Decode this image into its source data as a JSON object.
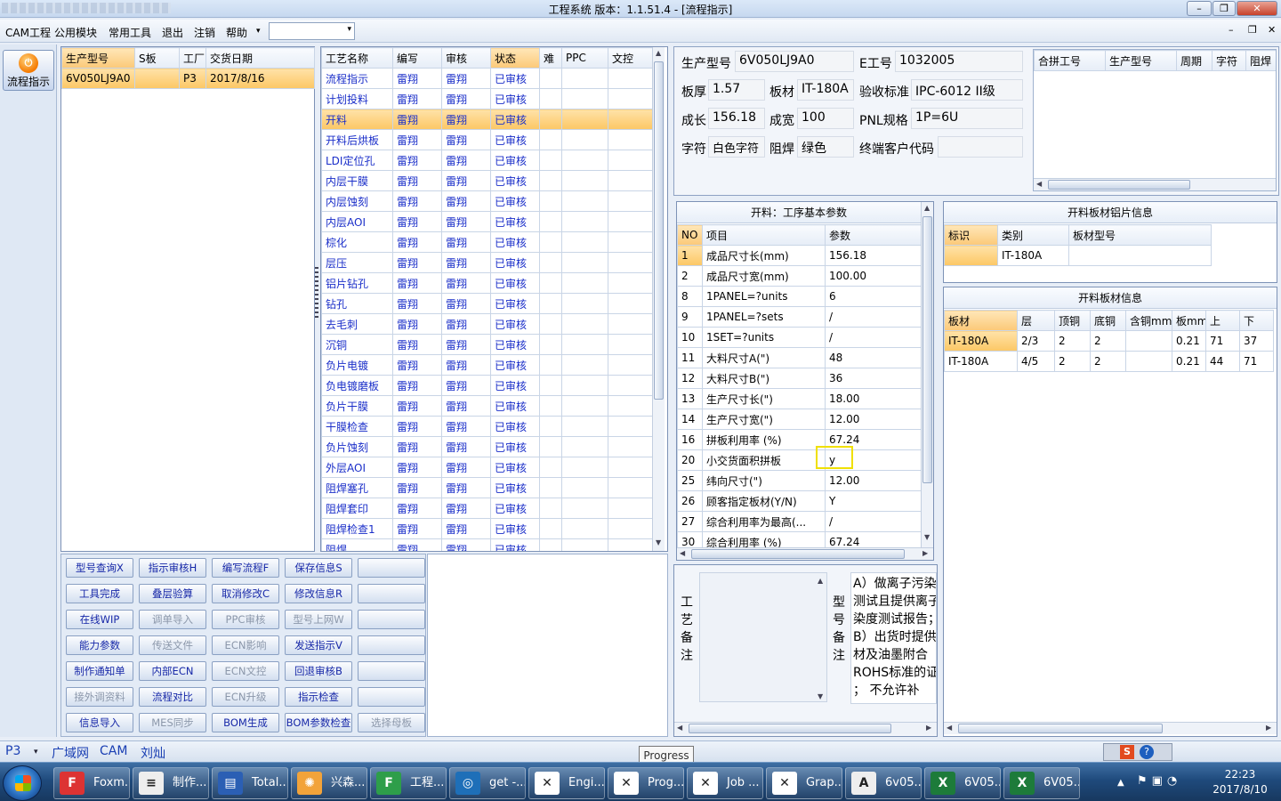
{
  "window": {
    "title": "工程系统   版本：1.1.51.4 - [流程指示]",
    "min": "–",
    "restore": "❐",
    "close": "✕"
  },
  "menu": {
    "items": [
      "CAM工程",
      "公用模块",
      "常用工具",
      "退出",
      "注销",
      "帮助"
    ],
    "help_arrow": "▾",
    "combo_arrow": "▾",
    "mdi": [
      "–",
      "❐",
      "✕"
    ]
  },
  "leftbar": {
    "flow_label": "流程指示"
  },
  "order_grid": {
    "headers": [
      "生产型号",
      "S板",
      "工厂",
      "交货日期"
    ],
    "rows": [
      [
        "6V050LJ9A0",
        "",
        "P3",
        "2017/8/16"
      ]
    ]
  },
  "process_grid": {
    "headers": [
      "工艺名称",
      "编写",
      "审核",
      "状态",
      "难",
      "PPC",
      "文控"
    ],
    "rows": [
      [
        "流程指示",
        "雷翔",
        "雷翔",
        "已审核"
      ],
      [
        "计划投料",
        "雷翔",
        "雷翔",
        "已审核"
      ],
      [
        "开料",
        "雷翔",
        "雷翔",
        "已审核"
      ],
      [
        "开料后烘板",
        "雷翔",
        "雷翔",
        "已审核"
      ],
      [
        "LDI定位孔",
        "雷翔",
        "雷翔",
        "已审核"
      ],
      [
        "内层干膜",
        "雷翔",
        "雷翔",
        "已审核"
      ],
      [
        "内层蚀刻",
        "雷翔",
        "雷翔",
        "已审核"
      ],
      [
        "内层AOI",
        "雷翔",
        "雷翔",
        "已审核"
      ],
      [
        "棕化",
        "雷翔",
        "雷翔",
        "已审核"
      ],
      [
        "层压",
        "雷翔",
        "雷翔",
        "已审核"
      ],
      [
        "铝片钻孔",
        "雷翔",
        "雷翔",
        "已审核"
      ],
      [
        "钻孔",
        "雷翔",
        "雷翔",
        "已审核"
      ],
      [
        "去毛刺",
        "雷翔",
        "雷翔",
        "已审核"
      ],
      [
        "沉铜",
        "雷翔",
        "雷翔",
        "已审核"
      ],
      [
        "负片电镀",
        "雷翔",
        "雷翔",
        "已审核"
      ],
      [
        "负电镀磨板",
        "雷翔",
        "雷翔",
        "已审核"
      ],
      [
        "负片干膜",
        "雷翔",
        "雷翔",
        "已审核"
      ],
      [
        "干膜检查",
        "雷翔",
        "雷翔",
        "已审核"
      ],
      [
        "负片蚀刻",
        "雷翔",
        "雷翔",
        "已审核"
      ],
      [
        "外层AOI",
        "雷翔",
        "雷翔",
        "已审核"
      ],
      [
        "阻焊塞孔",
        "雷翔",
        "雷翔",
        "已审核"
      ],
      [
        "阻焊套印",
        "雷翔",
        "雷翔",
        "已审核"
      ],
      [
        "阻焊检查1",
        "雷翔",
        "雷翔",
        "已审核"
      ],
      [
        "阻焊",
        "雷翔",
        "雷翔",
        "已审核"
      ]
    ]
  },
  "action_buttons": [
    [
      "型号查询X",
      "指示审核H",
      "编写流程F",
      "保存信息S",
      ""
    ],
    [
      "工具完成",
      "叠层验算",
      "取消修改C",
      "修改信息R",
      ""
    ],
    [
      "在线WIP",
      "调单导入",
      "PPC审核",
      "型号上网W",
      ""
    ],
    [
      "能力参数",
      "传送文件",
      "ECN影响",
      "发送指示V",
      ""
    ],
    [
      "制作通知单",
      "内部ECN",
      "ECN文控",
      "回退审核B",
      ""
    ],
    [
      "接外调资料",
      "流程对比",
      "ECN升级",
      "指示检查",
      ""
    ],
    [
      "信息导入",
      "MES同步",
      "BOM生成",
      "BOM参数检查",
      "选择母板"
    ]
  ],
  "info": {
    "labels": {
      "model": "生产型号",
      "eno": "E工号",
      "thick": "板厚",
      "material": "板材",
      "standard": "验收标准",
      "len": "成长",
      "wid": "成宽",
      "pnl": "PNL规格",
      "silk": "字符",
      "mask": "阻焊",
      "customer": "终端客户代码"
    },
    "model": "6V050LJ9A0",
    "eno": "1032005",
    "thick": "1.57",
    "material": "IT-180A",
    "standard": "IPC-6012 II级",
    "len": "156.18",
    "wid": "100",
    "pnl": "1P=6U",
    "silk": "白色字符",
    "mask": "绿色",
    "customer": ""
  },
  "merge_grid": {
    "headers": [
      "合拼工号",
      "生产型号",
      "周期",
      "字符",
      "阻焊"
    ]
  },
  "param_panel": {
    "title": "开料：工序基本参数",
    "headers": [
      "NO",
      "项目",
      "参数"
    ],
    "rows": [
      [
        "1",
        "成品尺寸长(mm)",
        "156.18"
      ],
      [
        "2",
        "成品尺寸宽(mm)",
        "100.00"
      ],
      [
        "8",
        "1PANEL=?units",
        "6"
      ],
      [
        "9",
        "1PANEL=?sets",
        "/"
      ],
      [
        "10",
        "1SET=?units",
        "/"
      ],
      [
        "11",
        "大料尺寸A(\")",
        "48"
      ],
      [
        "12",
        "大料尺寸B(\")",
        "36"
      ],
      [
        "13",
        "生产尺寸长(\")",
        "18.00"
      ],
      [
        "14",
        "生产尺寸宽(\")",
        "12.00"
      ],
      [
        "16",
        "拼板利用率 (%)",
        "67.24"
      ],
      [
        "20",
        "小交货面积拼板",
        "y"
      ],
      [
        "25",
        "纬向尺寸(\")",
        "12.00"
      ],
      [
        "26",
        "顾客指定板材(Y/N)",
        "Y"
      ],
      [
        "27",
        "综合利用率为最高(...",
        "/"
      ],
      [
        "30",
        "综合利用率 (%)",
        "67.24"
      ]
    ]
  },
  "alu_panel": {
    "title": "开料板材铝片信息",
    "headers": [
      "标识",
      "类别",
      "板材型号"
    ],
    "rows": [
      [
        "",
        "IT-180A",
        ""
      ]
    ]
  },
  "board_panel": {
    "title": "开料板材信息",
    "headers": [
      "板材",
      "层",
      "顶铜",
      "底铜",
      "含铜mm",
      "板mm",
      "上",
      "下"
    ],
    "rows": [
      [
        "IT-180A",
        "2/3",
        "2",
        "2",
        "",
        "0.21",
        "71",
        "37"
      ],
      [
        "IT-180A",
        "4/5",
        "2",
        "2",
        "",
        "0.21",
        "44",
        "71"
      ]
    ]
  },
  "remarks": {
    "process_label": [
      "工",
      "艺",
      "备",
      "注"
    ],
    "model_label": [
      "型",
      "号",
      "备",
      "注"
    ],
    "model_text": [
      "A）做离子污染",
      "测试且提供离子",
      "染度测试报告；",
      "B）出货时提供",
      "材及油墨附合",
      "ROHS标准的证",
      "；    不允许补"
    ]
  },
  "statusbar": {
    "factory": "P3",
    "net": "广域网",
    "mode": "CAM",
    "user": "刘灿",
    "tooltip": "Progress"
  },
  "taskbar": {
    "items": [
      "Foxm...",
      "制作...",
      "Total...",
      "兴森...",
      "工程...",
      "get -...",
      "Engi...",
      "Prog...",
      "Job ...",
      "Grap...",
      "6v05...",
      "6V05...",
      "6V05..."
    ],
    "time": "22:23",
    "date": "2017/8/10"
  },
  "colors": {
    "selection": "#fcc765",
    "link_blue": "#1a2ec9",
    "highlight_box": "#f0e000"
  }
}
